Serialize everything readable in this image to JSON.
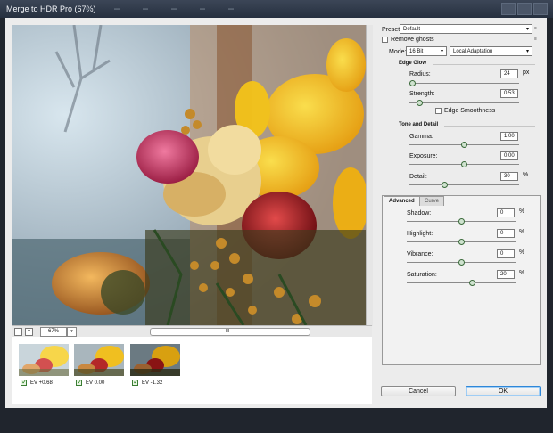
{
  "window": {
    "title": "Merge to HDR Pro (67%)"
  },
  "zoom": {
    "value": "67%",
    "zoom_out": "-",
    "zoom_in": "+",
    "dropdown": "▾",
    "grip": "III"
  },
  "sources": [
    {
      "label": "EV +0.68",
      "checked": true
    },
    {
      "label": "EV 0.00",
      "checked": true
    },
    {
      "label": "EV -1.32",
      "checked": true
    }
  ],
  "preset": {
    "label": "Preset:",
    "value": "Default",
    "menu_glyph": "≡"
  },
  "remove_ghosts": {
    "label": "Remove ghosts",
    "checked": false
  },
  "mode": {
    "label": "Mode:",
    "bit_depth": "16 Bit",
    "method": "Local Adaptation"
  },
  "edge_glow": {
    "title": "Edge Glow",
    "radius": {
      "label": "Radius:",
      "value": "24",
      "unit": "px",
      "slider": 0.03
    },
    "strength": {
      "label": "Strength:",
      "value": "0.53",
      "slider": 0.1
    },
    "edge_smoothness": {
      "label": "Edge Smoothness",
      "checked": false
    }
  },
  "tone_detail": {
    "title": "Tone and Detail",
    "gamma": {
      "label": "Gamma:",
      "value": "1.00",
      "slider": 0.5
    },
    "exposure": {
      "label": "Exposure:",
      "value": "0.00",
      "slider": 0.5
    },
    "detail": {
      "label": "Detail:",
      "value": "30",
      "unit": "%",
      "slider": 0.32
    }
  },
  "tabs": {
    "advanced": "Advanced",
    "curve": "Curve"
  },
  "advanced": {
    "shadow": {
      "label": "Shadow:",
      "value": "0",
      "unit": "%",
      "slider": 0.5
    },
    "highlight": {
      "label": "Highlight:",
      "value": "0",
      "unit": "%",
      "slider": 0.5
    },
    "vibrance": {
      "label": "Vibrance:",
      "value": "0",
      "unit": "%",
      "slider": 0.5
    },
    "saturation": {
      "label": "Saturation:",
      "value": "20",
      "unit": "%",
      "slider": 0.6
    }
  },
  "buttons": {
    "cancel": "Cancel",
    "ok": "OK"
  },
  "colors": {
    "title_bar": "#2c3545",
    "dialog": "#ececec",
    "ok_border": "#2f87d8",
    "check": "#1e7a14"
  }
}
